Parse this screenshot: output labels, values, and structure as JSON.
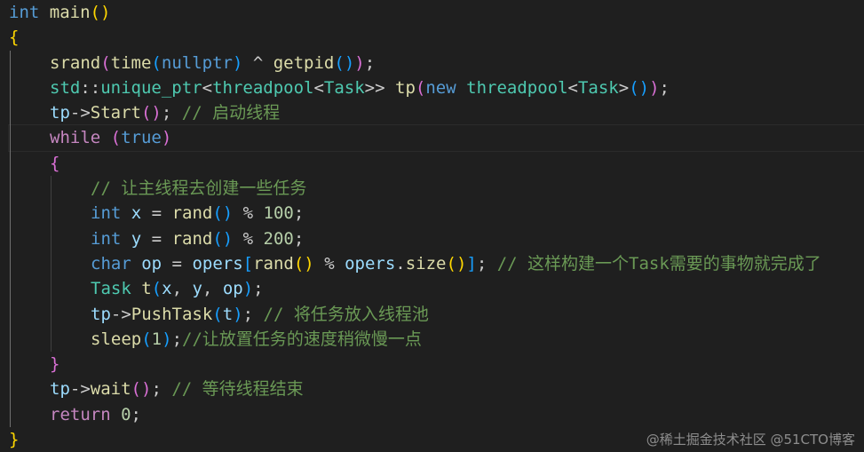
{
  "editor": {
    "lines": [
      {
        "indent": 0,
        "tokens": [
          {
            "t": "int",
            "c": "kw"
          },
          {
            "t": " ",
            "c": "pl"
          },
          {
            "t": "main",
            "c": "fn"
          },
          {
            "t": "()",
            "c": "b1"
          }
        ]
      },
      {
        "indent": 0,
        "tokens": [
          {
            "t": "{",
            "c": "b1"
          }
        ]
      },
      {
        "indent": 1,
        "tokens": [
          {
            "t": "srand",
            "c": "fn"
          },
          {
            "t": "(",
            "c": "b2"
          },
          {
            "t": "time",
            "c": "fn"
          },
          {
            "t": "(",
            "c": "b3"
          },
          {
            "t": "nullptr",
            "c": "kw"
          },
          {
            "t": ")",
            "c": "b3"
          },
          {
            "t": " ^ ",
            "c": "pl"
          },
          {
            "t": "getpid",
            "c": "fn"
          },
          {
            "t": "()",
            "c": "b3"
          },
          {
            "t": ")",
            "c": "b2"
          },
          {
            "t": ";",
            "c": "pl"
          }
        ]
      },
      {
        "indent": 1,
        "tokens": [
          {
            "t": "std",
            "c": "ty"
          },
          {
            "t": "::",
            "c": "pl"
          },
          {
            "t": "unique_ptr",
            "c": "ty"
          },
          {
            "t": "<",
            "c": "pl"
          },
          {
            "t": "threadpool",
            "c": "ty"
          },
          {
            "t": "<",
            "c": "pl"
          },
          {
            "t": "Task",
            "c": "ty"
          },
          {
            "t": ">>",
            "c": "pl"
          },
          {
            "t": " ",
            "c": "pl"
          },
          {
            "t": "tp",
            "c": "fn"
          },
          {
            "t": "(",
            "c": "b2"
          },
          {
            "t": "new",
            "c": "kw"
          },
          {
            "t": " ",
            "c": "pl"
          },
          {
            "t": "threadpool",
            "c": "ty"
          },
          {
            "t": "<",
            "c": "pl"
          },
          {
            "t": "Task",
            "c": "ty"
          },
          {
            "t": ">",
            "c": "pl"
          },
          {
            "t": "()",
            "c": "b3"
          },
          {
            "t": ")",
            "c": "b2"
          },
          {
            "t": ";",
            "c": "pl"
          }
        ]
      },
      {
        "indent": 1,
        "tokens": [
          {
            "t": "tp",
            "c": "var"
          },
          {
            "t": "->",
            "c": "pl"
          },
          {
            "t": "Start",
            "c": "fn"
          },
          {
            "t": "()",
            "c": "b2"
          },
          {
            "t": "; ",
            "c": "pl"
          },
          {
            "t": "// 启动线程",
            "c": "cm"
          }
        ]
      },
      {
        "indent": 1,
        "current": true,
        "tokens": [
          {
            "t": "while",
            "c": "ctl"
          },
          {
            "t": " ",
            "c": "pl"
          },
          {
            "t": "(",
            "c": "b2"
          },
          {
            "t": "true",
            "c": "kw"
          },
          {
            "t": ")",
            "c": "b2"
          }
        ]
      },
      {
        "indent": 1,
        "tokens": [
          {
            "t": "{",
            "c": "b2"
          }
        ]
      },
      {
        "indent": 2,
        "tokens": [
          {
            "t": "// 让主线程去创建一些任务",
            "c": "cm"
          }
        ]
      },
      {
        "indent": 2,
        "tokens": [
          {
            "t": "int",
            "c": "kw"
          },
          {
            "t": " ",
            "c": "pl"
          },
          {
            "t": "x",
            "c": "var"
          },
          {
            "t": " = ",
            "c": "pl"
          },
          {
            "t": "rand",
            "c": "fn"
          },
          {
            "t": "()",
            "c": "b3"
          },
          {
            "t": " % ",
            "c": "pl"
          },
          {
            "t": "100",
            "c": "num"
          },
          {
            "t": ";",
            "c": "pl"
          }
        ]
      },
      {
        "indent": 2,
        "tokens": [
          {
            "t": "int",
            "c": "kw"
          },
          {
            "t": " ",
            "c": "pl"
          },
          {
            "t": "y",
            "c": "var"
          },
          {
            "t": " = ",
            "c": "pl"
          },
          {
            "t": "rand",
            "c": "fn"
          },
          {
            "t": "()",
            "c": "b3"
          },
          {
            "t": " % ",
            "c": "pl"
          },
          {
            "t": "200",
            "c": "num"
          },
          {
            "t": ";",
            "c": "pl"
          }
        ]
      },
      {
        "indent": 2,
        "tokens": [
          {
            "t": "char",
            "c": "kw"
          },
          {
            "t": " ",
            "c": "pl"
          },
          {
            "t": "op",
            "c": "var"
          },
          {
            "t": " = ",
            "c": "pl"
          },
          {
            "t": "opers",
            "c": "var"
          },
          {
            "t": "[",
            "c": "b3"
          },
          {
            "t": "rand",
            "c": "fn"
          },
          {
            "t": "()",
            "c": "b1"
          },
          {
            "t": " % ",
            "c": "pl"
          },
          {
            "t": "opers",
            "c": "var"
          },
          {
            "t": ".",
            "c": "pl"
          },
          {
            "t": "size",
            "c": "fn"
          },
          {
            "t": "()",
            "c": "b1"
          },
          {
            "t": "]",
            "c": "b3"
          },
          {
            "t": "; ",
            "c": "pl"
          },
          {
            "t": "// 这样构建一个Task需要的事物就完成了",
            "c": "cm"
          }
        ]
      },
      {
        "indent": 2,
        "tokens": [
          {
            "t": "Task",
            "c": "ty"
          },
          {
            "t": " ",
            "c": "pl"
          },
          {
            "t": "t",
            "c": "fn"
          },
          {
            "t": "(",
            "c": "b3"
          },
          {
            "t": "x",
            "c": "var"
          },
          {
            "t": ", ",
            "c": "pl"
          },
          {
            "t": "y",
            "c": "var"
          },
          {
            "t": ", ",
            "c": "pl"
          },
          {
            "t": "op",
            "c": "var"
          },
          {
            "t": ")",
            "c": "b3"
          },
          {
            "t": ";",
            "c": "pl"
          }
        ]
      },
      {
        "indent": 2,
        "tokens": [
          {
            "t": "tp",
            "c": "var"
          },
          {
            "t": "->",
            "c": "pl"
          },
          {
            "t": "PushTask",
            "c": "fn"
          },
          {
            "t": "(",
            "c": "b3"
          },
          {
            "t": "t",
            "c": "var"
          },
          {
            "t": ")",
            "c": "b3"
          },
          {
            "t": "; ",
            "c": "pl"
          },
          {
            "t": "// 将任务放入线程池",
            "c": "cm"
          }
        ]
      },
      {
        "indent": 2,
        "tokens": [
          {
            "t": "sleep",
            "c": "fn"
          },
          {
            "t": "(",
            "c": "b3"
          },
          {
            "t": "1",
            "c": "num"
          },
          {
            "t": ")",
            "c": "b3"
          },
          {
            "t": ";",
            "c": "pl"
          },
          {
            "t": "//让放置任务的速度稍微慢一点",
            "c": "cm"
          }
        ]
      },
      {
        "indent": 1,
        "tokens": [
          {
            "t": "}",
            "c": "b2"
          }
        ]
      },
      {
        "indent": 1,
        "tokens": [
          {
            "t": "tp",
            "c": "var"
          },
          {
            "t": "->",
            "c": "pl"
          },
          {
            "t": "wait",
            "c": "fn"
          },
          {
            "t": "()",
            "c": "b2"
          },
          {
            "t": "; ",
            "c": "pl"
          },
          {
            "t": "// 等待线程结束",
            "c": "cm"
          }
        ]
      },
      {
        "indent": 1,
        "tokens": [
          {
            "t": "return",
            "c": "ctl"
          },
          {
            "t": " ",
            "c": "pl"
          },
          {
            "t": "0",
            "c": "num"
          },
          {
            "t": ";",
            "c": "pl"
          }
        ]
      },
      {
        "indent": 0,
        "tokens": [
          {
            "t": "}",
            "c": "b1"
          }
        ]
      }
    ]
  },
  "watermark": {
    "text": "@稀土掘金技术社区 @51CTO博客"
  },
  "colors": {
    "background": "#1f1f1f",
    "keyword": "#569cd6",
    "control": "#c586c0",
    "function": "#dcdcaa",
    "type": "#4ec9b0",
    "variable": "#9cdcfe",
    "number": "#b5cea8",
    "comment": "#6a9955",
    "bracket_level1": "#ffd700",
    "bracket_level2": "#da70d6",
    "bracket_level3": "#179fff"
  }
}
